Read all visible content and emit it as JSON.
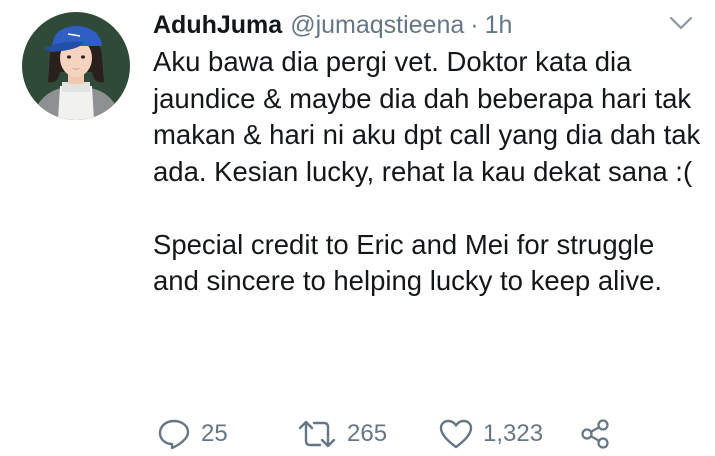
{
  "tweet": {
    "display_name": "AduhJuma",
    "handle": "@jumaqstieena",
    "separator": "·",
    "timestamp": "1h",
    "paragraphs": [
      "Aku bawa dia pergi vet. Doktor kata dia jaundice & maybe dia dah beberapa hari tak makan & hari ni aku dpt call yang dia dah tak ada. Kesian lucky, rehat la kau dekat sana :(",
      "Special credit to Eric and Mei for struggle and sincere to helping lucky to keep alive."
    ]
  },
  "actions": {
    "reply": {
      "icon": "reply-icon",
      "count": "25"
    },
    "retweet": {
      "icon": "retweet-icon",
      "count": "265"
    },
    "like": {
      "icon": "heart-icon",
      "count": "1,323"
    },
    "share": {
      "icon": "share-icon"
    }
  },
  "colors": {
    "text": "#14171a",
    "secondary": "#657786",
    "avatar_bg": "#2f4a38"
  }
}
